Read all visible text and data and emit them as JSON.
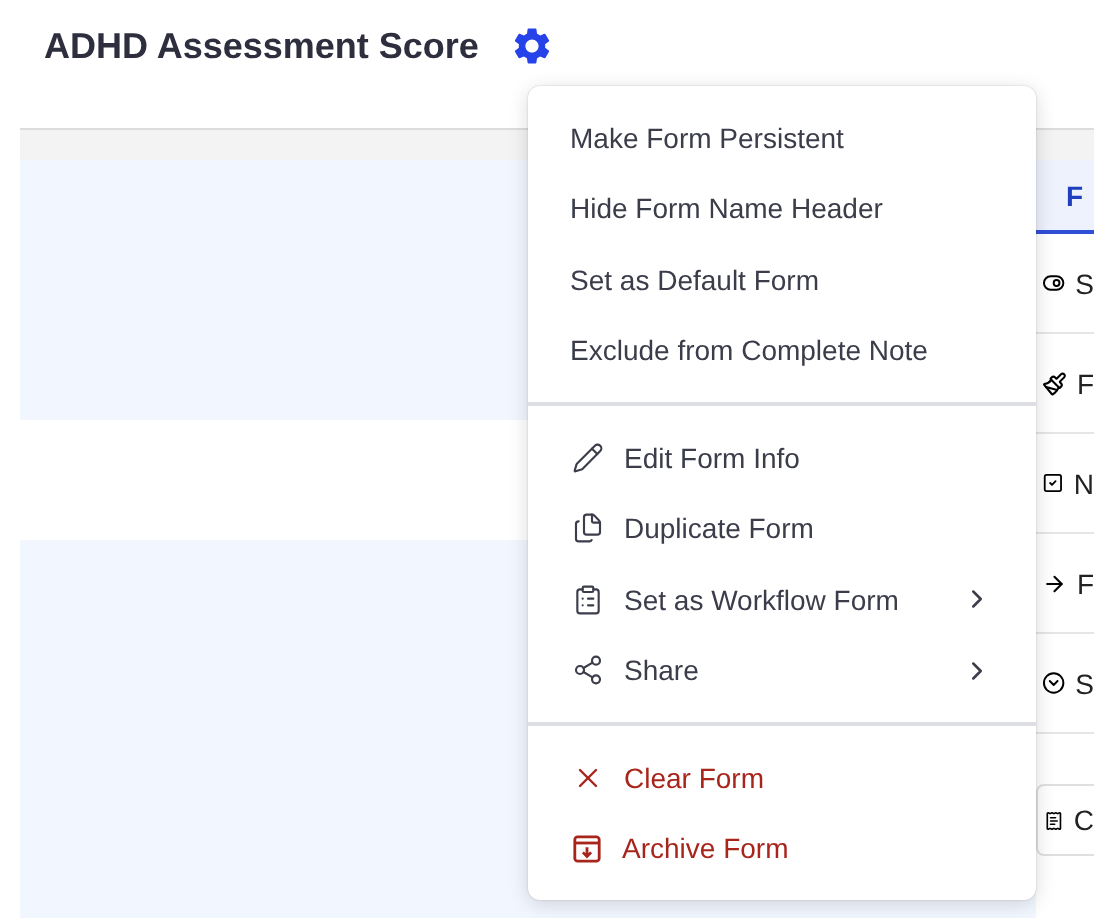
{
  "title": "ADHD Assessment Score",
  "menu": {
    "sections": [
      [
        {
          "label": "Make Form Persistent",
          "kind": "plain",
          "danger": false,
          "submenu": false
        },
        {
          "label": "Hide Form Name Header",
          "kind": "plain",
          "danger": false,
          "submenu": false
        },
        {
          "label": "Set as Default Form",
          "kind": "plain",
          "danger": false,
          "submenu": false
        },
        {
          "label": "Exclude from Complete Note",
          "kind": "plain",
          "danger": false,
          "submenu": false
        }
      ],
      [
        {
          "label": "Edit Form Info",
          "kind": "edit",
          "danger": false,
          "submenu": false
        },
        {
          "label": "Duplicate Form",
          "kind": "duplicate",
          "danger": false,
          "submenu": false
        },
        {
          "label": "Set as Workflow Form",
          "kind": "clipboard",
          "danger": false,
          "submenu": true
        },
        {
          "label": "Share",
          "kind": "share",
          "danger": false,
          "submenu": true
        }
      ],
      [
        {
          "label": "Clear Form",
          "kind": "clear",
          "danger": true,
          "submenu": false
        },
        {
          "label": "Archive Form",
          "kind": "archive",
          "danger": true,
          "submenu": false
        }
      ]
    ]
  },
  "side_panel": {
    "tab": {
      "label": "F",
      "selected": true
    },
    "items": [
      {
        "kind": "toggle",
        "label": "S"
      },
      {
        "kind": "brush",
        "label": "F"
      },
      {
        "kind": "checkbox",
        "label": "N"
      },
      {
        "kind": "arrow",
        "label": "F"
      },
      {
        "kind": "dropdown",
        "label": "S"
      },
      {
        "kind": "card",
        "label": "C"
      }
    ]
  }
}
